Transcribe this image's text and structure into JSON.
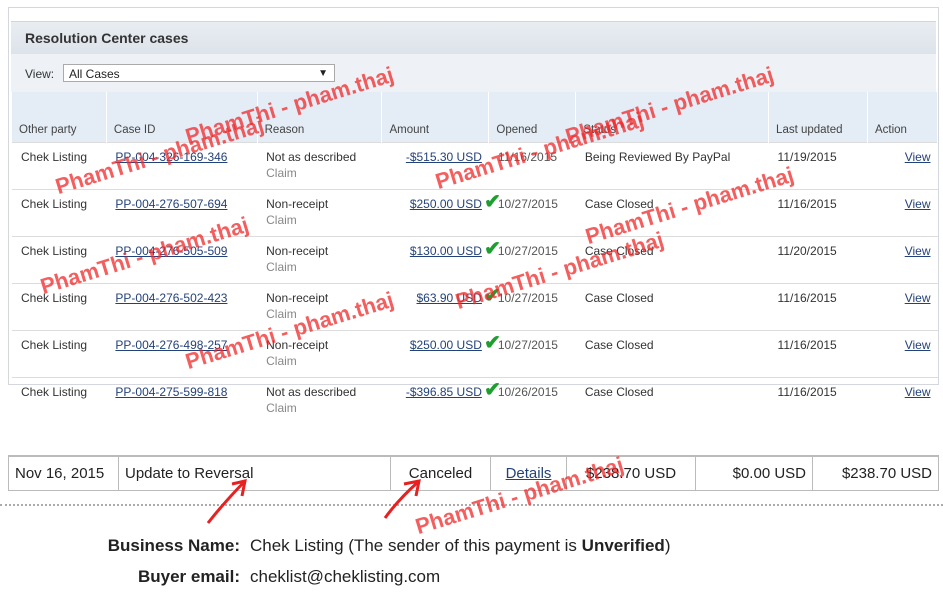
{
  "panel": {
    "title": "Resolution Center cases",
    "view_label": "View:",
    "view_selected": "All Cases"
  },
  "columns": [
    "Other party",
    "Case ID",
    "Reason",
    "Amount",
    "Opened",
    "Status",
    "Last updated",
    "Action"
  ],
  "cases": [
    {
      "party": "Chek Listing",
      "case_id": "PP-004-326-169-346",
      "reason": "Not as described",
      "type": "Claim",
      "amount": "-$515.30 USD",
      "opened": "11/16/2015",
      "status": "Being Reviewed By PayPal",
      "updated": "11/19/2015",
      "action": "View",
      "checked": false
    },
    {
      "party": "Chek Listing",
      "case_id": "PP-004-276-507-694",
      "reason": "Non-receipt",
      "type": "Claim",
      "amount": "$250.00 USD",
      "opened": "10/27/2015",
      "status": "Case Closed",
      "updated": "11/16/2015",
      "action": "View",
      "checked": true
    },
    {
      "party": "Chek Listing",
      "case_id": "PP-004-276-505-509",
      "reason": "Non-receipt",
      "type": "Claim",
      "amount": "$130.00 USD",
      "opened": "10/27/2015",
      "status": "Case Closed",
      "updated": "11/20/2015",
      "action": "View",
      "checked": true
    },
    {
      "party": "Chek Listing",
      "case_id": "PP-004-276-502-423",
      "reason": "Non-receipt",
      "type": "Claim",
      "amount": "$63.90 USD",
      "opened": "10/27/2015",
      "status": "Case Closed",
      "updated": "11/16/2015",
      "action": "View",
      "checked": true
    },
    {
      "party": "Chek Listing",
      "case_id": "PP-004-276-498-257",
      "reason": "Non-receipt",
      "type": "Claim",
      "amount": "$250.00 USD",
      "opened": "10/27/2015",
      "status": "Case Closed",
      "updated": "11/16/2015",
      "action": "View",
      "checked": true
    },
    {
      "party": "Chek Listing",
      "case_id": "PP-004-275-599-818",
      "reason": "Not as described",
      "type": "Claim",
      "amount": "-$396.85 USD",
      "opened": "10/26/2015",
      "status": "Case Closed",
      "updated": "11/16/2015",
      "action": "View",
      "checked": true
    }
  ],
  "transaction": {
    "date": "Nov 16, 2015",
    "type": "Update to Reversal",
    "status": "Canceled",
    "details": "Details",
    "gross": "$238.70 USD",
    "fee": "$0.00 USD",
    "net": "$238.70 USD"
  },
  "info": {
    "business_label": "Business Name:",
    "business_value": "Chek Listing (The sender of this payment is ",
    "business_status": "Unverified",
    "business_close": ")",
    "email_label": "Buyer email:",
    "email_value": "cheklist@cheklisting.com"
  },
  "watermark": "PhamThi - pham.thaj",
  "colors": {
    "watermark": "#f02828",
    "check": "#1f9e2f",
    "link": "#24427a"
  }
}
